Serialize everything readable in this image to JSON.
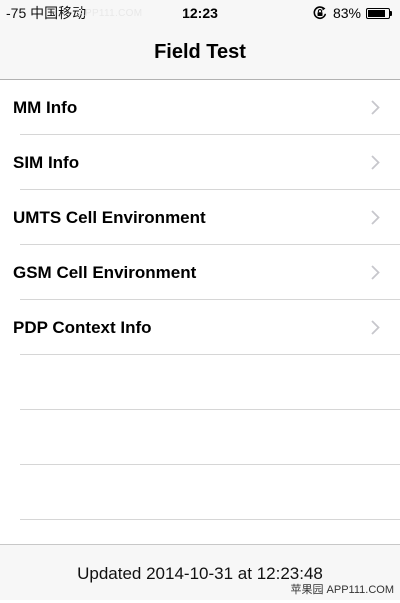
{
  "status_bar": {
    "signal": "-75",
    "carrier": "中国移动",
    "watermark": "APP111.COM",
    "time": "12:23",
    "battery_percent": "83%",
    "battery_level": 0.83
  },
  "nav": {
    "title": "Field Test"
  },
  "menu": {
    "items": [
      {
        "label": "MM Info"
      },
      {
        "label": "SIM Info"
      },
      {
        "label": "UMTS Cell Environment"
      },
      {
        "label": "GSM Cell Environment"
      },
      {
        "label": "PDP Context Info"
      }
    ]
  },
  "footer": {
    "updated_text": "Updated 2014-10-31 at 12:23:48",
    "watermark": "苹果园 APP111.COM"
  },
  "icons": {
    "lock": "rotation-lock-icon",
    "battery": "battery-icon",
    "chevron": "chevron-right-icon"
  }
}
